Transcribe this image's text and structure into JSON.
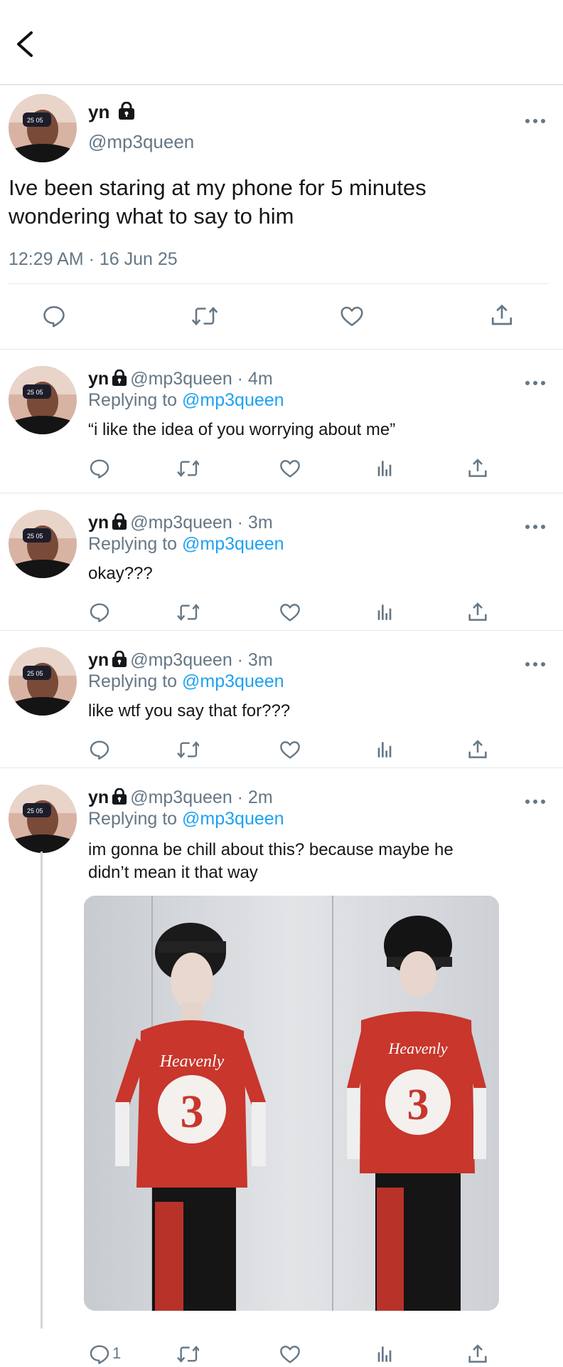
{
  "header": {
    "back_icon": "chevron-left-icon"
  },
  "main_tweet": {
    "name": "yn",
    "handle": "@mp3queen",
    "text_line1": "Ive been staring at my phone for 5 minutes",
    "text_line2": "wondering  what to say to him",
    "timestamp": "12:29 AM · 16 Jun 25"
  },
  "replies": [
    {
      "name": "yn",
      "meta": "@mp3queen · 4m",
      "replying_label": "Replying to",
      "replying_handle": "@mp3queen",
      "text": "“i like the idea of you worrying about me”"
    },
    {
      "name": "yn",
      "meta": "@mp3queen · 3m",
      "replying_label": "Replying to",
      "replying_handle": "@mp3queen",
      "text": "okay???"
    },
    {
      "name": "yn",
      "meta": "@mp3queen · 3m",
      "replying_label": "Replying to",
      "replying_handle": "@mp3queen",
      "text": "like wtf you say that for???"
    },
    {
      "name": "yn",
      "meta": "@mp3queen · 2m",
      "replying_label": "Replying to",
      "replying_handle": "@mp3queen",
      "text_line1": "im gonna be chill about this? because maybe he",
      "text_line2": "didn’t mean it that way",
      "reply_count": "1"
    }
  ],
  "photo": {
    "shirt_text_left": "Heavenly",
    "shirt_number_left": "3",
    "shirt_text_right": "Heavenly",
    "shirt_number_right": "3"
  },
  "colors": {
    "accent": "#1da1f2",
    "grey": "#657786",
    "divider": "#e1e8ed",
    "icon": "#657786"
  }
}
